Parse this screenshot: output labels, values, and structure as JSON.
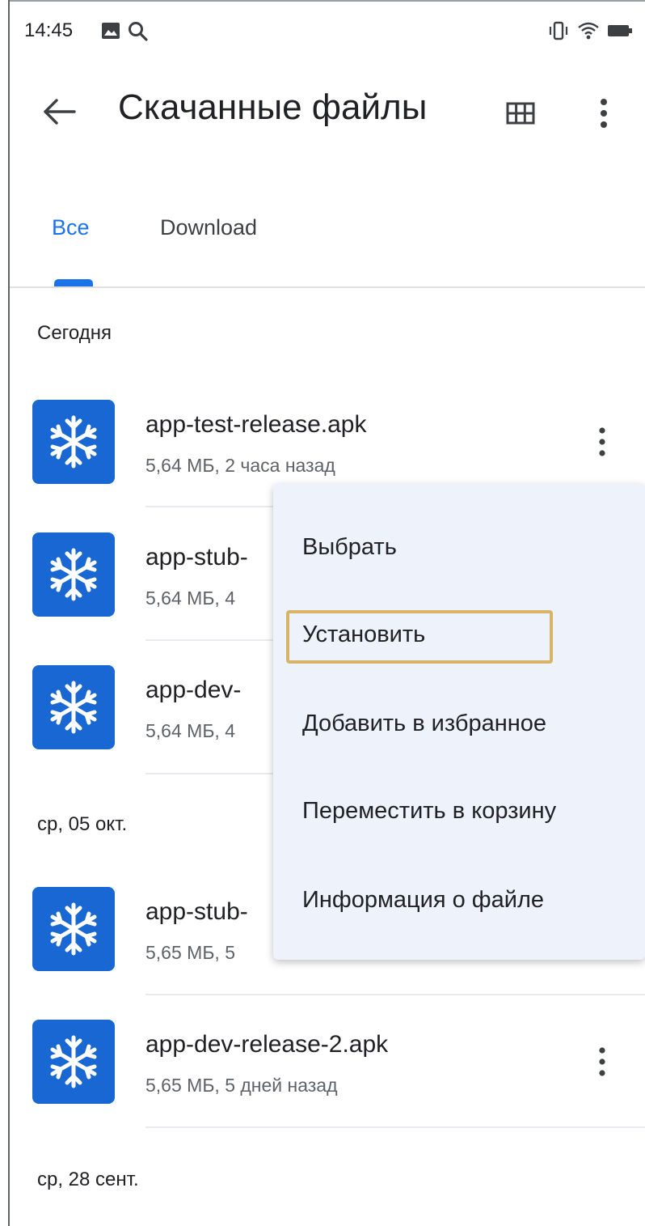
{
  "status_bar": {
    "time": "14:45",
    "icons": [
      "image-icon",
      "search-icon",
      "vibrate-icon",
      "wifi-icon",
      "battery-icon"
    ]
  },
  "toolbar": {
    "title": "Скачанные файлы",
    "icons": [
      "back-arrow-icon",
      "grid-view-icon",
      "more-vert-icon"
    ]
  },
  "tabs": [
    {
      "label": "Все",
      "selected": true
    },
    {
      "label": "Download",
      "selected": false
    }
  ],
  "colors": {
    "accent": "#1a73e8",
    "file_icon_bg": "#1967d2",
    "menu_bg": "#eef2fb",
    "highlight_border": "#d7b46a"
  },
  "sections": [
    {
      "header": "Сегодня",
      "files": [
        {
          "name": "app-test-release.apk",
          "meta": "5,64 МБ, 2 часа назад"
        },
        {
          "name": "app-stub-",
          "meta": "5,64 МБ, 4"
        },
        {
          "name": "app-dev-",
          "meta": "5,64 МБ, 4"
        }
      ]
    },
    {
      "header": "ср, 05 окт.",
      "files": [
        {
          "name": "app-stub-",
          "meta": "5,65 МБ, 5"
        },
        {
          "name": "app-dev-release-2.apk",
          "meta": "5,65 МБ, 5 дней назад"
        }
      ]
    },
    {
      "header": "ср, 28 сент.",
      "files": []
    }
  ],
  "menu": {
    "items": [
      {
        "label": "Выбрать"
      },
      {
        "label": "Установить",
        "highlighted": true
      },
      {
        "label": "Добавить в избранное"
      },
      {
        "label": "Переместить в корзину"
      },
      {
        "label": "Информация о файле"
      }
    ]
  }
}
